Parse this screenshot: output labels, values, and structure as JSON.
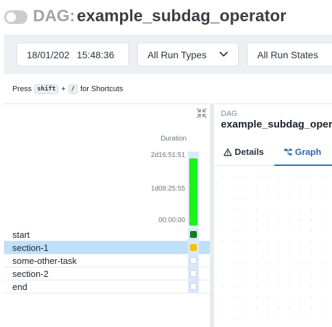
{
  "header": {
    "dag_prefix": "DAG:",
    "dag_id": "example_subdag_operator"
  },
  "filters": {
    "date": "18/01/202",
    "time": "15:48:36",
    "run_type": "All Run Types",
    "run_state": "All Run States"
  },
  "shortcuts": {
    "press": "Press",
    "key1": "shift",
    "plus": "+",
    "key2": "/",
    "suffix": "for Shortcuts"
  },
  "grid": {
    "duration_label": "Duration",
    "ticks": {
      "max": "2d16:51:51",
      "mid": "1d08:25:55",
      "min": "00:00:00"
    },
    "run_duration_fraction": 0.92,
    "tasks": [
      {
        "label": "start",
        "status": "success",
        "selected": false
      },
      {
        "label": "section-1",
        "status": "running",
        "selected": true
      },
      {
        "label": "some-other-task",
        "status": "none",
        "selected": false
      },
      {
        "label": "section-2",
        "status": "none",
        "selected": false
      },
      {
        "label": "end",
        "status": "none",
        "selected": false
      }
    ]
  },
  "panel": {
    "kicker": "DAG",
    "title": "example_subdag_operator",
    "tabs": {
      "details": "Details",
      "graph": "Graph"
    },
    "active_tab": "Graph"
  },
  "colors": {
    "success": "#1a7a1a",
    "running": "#f2c20c",
    "none": "#ffffff",
    "duration_bar": "#1cf21c",
    "accent": "#2b6cb0"
  }
}
